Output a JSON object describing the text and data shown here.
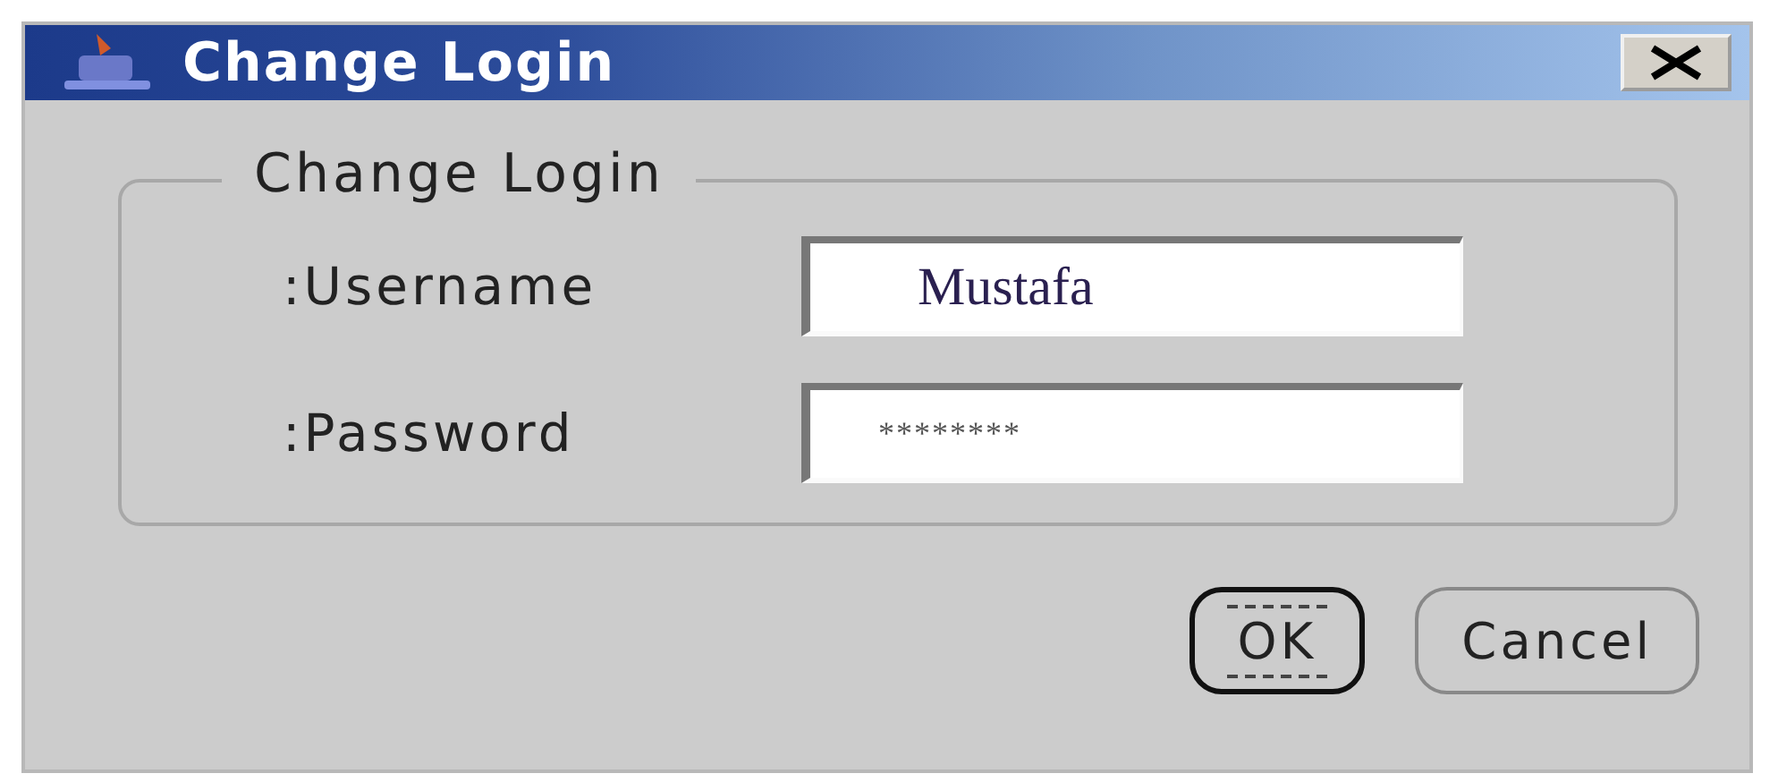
{
  "window": {
    "title": "Change Login"
  },
  "group": {
    "title": "Change Login"
  },
  "fields": [
    {
      "label": ":Username",
      "value": "Mustafa",
      "kind": "text"
    },
    {
      "label": ":Password",
      "value": "********",
      "kind": "password"
    }
  ],
  "buttons": [
    {
      "label": "OK",
      "focused": true
    },
    {
      "label": "Cancel",
      "focused": false
    }
  ]
}
